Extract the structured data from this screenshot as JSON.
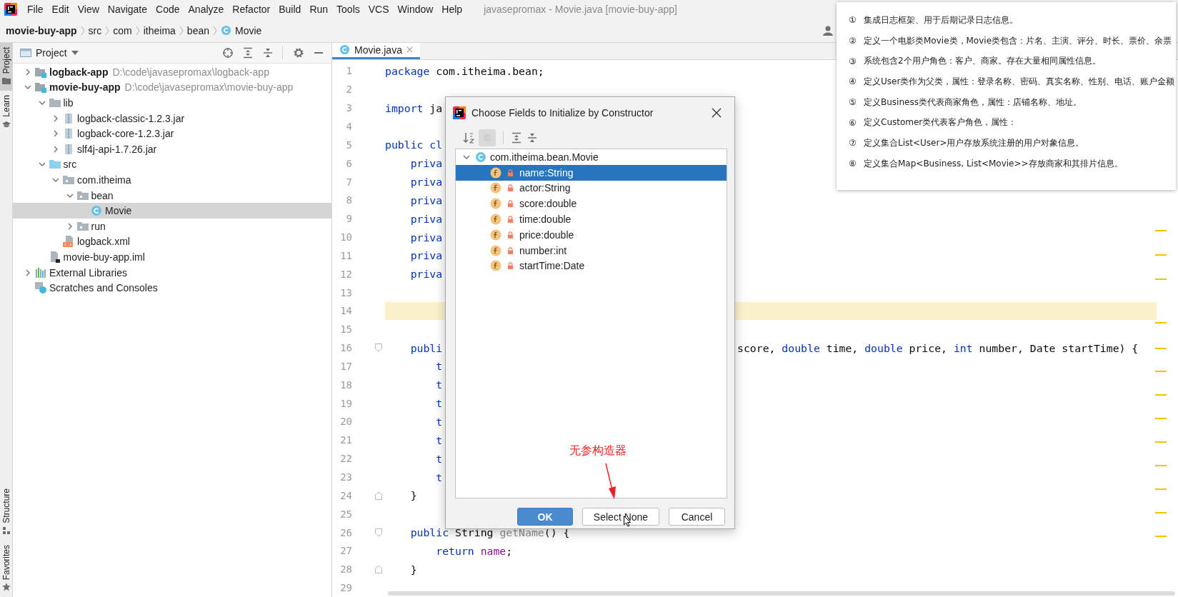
{
  "menu": {
    "items": [
      "File",
      "Edit",
      "View",
      "Navigate",
      "Code",
      "Analyze",
      "Refactor",
      "Build",
      "Run",
      "Tools",
      "VCS",
      "Window",
      "Help"
    ],
    "title": "javasepromax - Movie.java [movie-buy-app]"
  },
  "breadcrumb": [
    {
      "label": "movie-buy-app",
      "kind": "project"
    },
    {
      "label": "src",
      "kind": "folder"
    },
    {
      "label": "com",
      "kind": "folder"
    },
    {
      "label": "itheima",
      "kind": "folder"
    },
    {
      "label": "bean",
      "kind": "folder"
    },
    {
      "label": "Movie",
      "kind": "class"
    }
  ],
  "tool_strip": {
    "top": [
      {
        "label": "Project",
        "kind": "folder",
        "selected": true
      },
      {
        "label": "Learn",
        "kind": "hat",
        "selected": false
      }
    ],
    "bottom": [
      {
        "label": "Structure",
        "kind": "structure",
        "selected": false
      },
      {
        "label": "Favorites",
        "kind": "star",
        "selected": false
      }
    ]
  },
  "project": {
    "title": "Project",
    "tree": [
      {
        "label": "logback-app",
        "path": "D:\\code\\javasepromax\\logback-app",
        "kind": "module",
        "expanded": false,
        "selected": false
      },
      {
        "label": "movie-buy-app",
        "path": "D:\\code\\javasepromax\\movie-buy-app",
        "kind": "module",
        "expanded": true,
        "selected": false,
        "children": [
          {
            "label": "lib",
            "kind": "folder",
            "expanded": true,
            "selected": false,
            "children": [
              {
                "label": "logback-classic-1.2.3.jar",
                "kind": "jar",
                "expanded": false,
                "selected": false
              },
              {
                "label": "logback-core-1.2.3.jar",
                "kind": "jar",
                "expanded": false,
                "selected": false
              },
              {
                "label": "slf4j-api-1.7.26.jar",
                "kind": "jar",
                "expanded": false,
                "selected": false
              }
            ]
          },
          {
            "label": "src",
            "kind": "source",
            "expanded": true,
            "selected": false,
            "children": [
              {
                "label": "com.itheima",
                "kind": "package",
                "expanded": true,
                "selected": false,
                "children": [
                  {
                    "label": "bean",
                    "kind": "package",
                    "expanded": true,
                    "selected": false,
                    "children": [
                      {
                        "label": "Movie",
                        "kind": "class",
                        "selected": true
                      }
                    ]
                  },
                  {
                    "label": "run",
                    "kind": "package",
                    "expanded": false,
                    "selected": false
                  }
                ]
              },
              {
                "label": "logback.xml",
                "kind": "xml",
                "selected": false
              }
            ]
          },
          {
            "label": "movie-buy-app.iml",
            "kind": "iml",
            "selected": false
          }
        ]
      },
      {
        "label": "External Libraries",
        "kind": "libraries",
        "expanded": false,
        "selected": false
      },
      {
        "label": "Scratches and Consoles",
        "kind": "scratches",
        "selected": false
      }
    ]
  },
  "editor": {
    "tabs": [
      {
        "label": "Movie.java",
        "selected": true
      }
    ],
    "lines": [
      {
        "number": "1",
        "current": false,
        "left": [
          {
            "kind": "keyword",
            "text": "package"
          },
          {
            "kind": "plain",
            "text": " com.itheima.bean;"
          }
        ]
      },
      {
        "number": "2",
        "current": false
      },
      {
        "number": "3",
        "current": false,
        "left": [
          {
            "kind": "keyword",
            "text": "import"
          },
          {
            "kind": "plain",
            "text": " ja"
          }
        ]
      },
      {
        "number": "4",
        "current": false
      },
      {
        "number": "5",
        "current": false,
        "left": [
          {
            "kind": "keyword",
            "text": "public cl"
          }
        ]
      },
      {
        "number": "6",
        "current": false,
        "left": [
          {
            "kind": "keyword",
            "text": "    priva"
          }
        ]
      },
      {
        "number": "7",
        "current": false,
        "left": [
          {
            "kind": "keyword",
            "text": "    priva"
          }
        ]
      },
      {
        "number": "8",
        "current": false,
        "left": [
          {
            "kind": "keyword",
            "text": "    priva"
          }
        ]
      },
      {
        "number": "9",
        "current": false,
        "left": [
          {
            "kind": "keyword",
            "text": "    priva"
          }
        ]
      },
      {
        "number": "10",
        "current": false,
        "left": [
          {
            "kind": "keyword",
            "text": "    priva"
          }
        ]
      },
      {
        "number": "11",
        "current": false,
        "left": [
          {
            "kind": "keyword",
            "text": "    priva"
          }
        ]
      },
      {
        "number": "12",
        "current": false,
        "left": [
          {
            "kind": "keyword",
            "text": "    priva"
          }
        ]
      },
      {
        "number": "13",
        "current": false
      },
      {
        "number": "14",
        "current": true
      },
      {
        "number": "15",
        "current": false
      },
      {
        "number": "16",
        "current": false,
        "kind": "fold_start",
        "left": [
          {
            "kind": "keyword",
            "text": "    publi"
          }
        ],
        "right": [
          {
            "kind": "plain",
            "text": "score, "
          },
          {
            "kind": "keyword",
            "text": "double"
          },
          {
            "kind": "plain",
            "text": " time, "
          },
          {
            "kind": "keyword",
            "text": "double"
          },
          {
            "kind": "plain",
            "text": " price, "
          },
          {
            "kind": "keyword",
            "text": "int"
          },
          {
            "kind": "plain",
            "text": " number, Date startTime) {"
          }
        ]
      },
      {
        "number": "17",
        "current": false,
        "left": [
          {
            "kind": "keyword",
            "text": "        t"
          }
        ]
      },
      {
        "number": "18",
        "current": false,
        "left": [
          {
            "kind": "keyword",
            "text": "        t"
          }
        ]
      },
      {
        "number": "19",
        "current": false,
        "left": [
          {
            "kind": "keyword",
            "text": "        t"
          }
        ]
      },
      {
        "number": "20",
        "current": false,
        "left": [
          {
            "kind": "keyword",
            "text": "        t"
          }
        ]
      },
      {
        "number": "21",
        "current": false,
        "left": [
          {
            "kind": "keyword",
            "text": "        t"
          }
        ]
      },
      {
        "number": "22",
        "current": false,
        "left": [
          {
            "kind": "keyword",
            "text": "        t"
          }
        ]
      },
      {
        "number": "23",
        "current": false,
        "left": [
          {
            "kind": "keyword",
            "text": "        t"
          }
        ]
      },
      {
        "number": "24",
        "current": false,
        "kind": "fold_end",
        "left": [
          {
            "kind": "plain",
            "text": "    }"
          }
        ]
      },
      {
        "number": "25",
        "current": false
      },
      {
        "number": "26",
        "current": false,
        "kind": "fold_start",
        "left": [
          {
            "kind": "keyword",
            "text": "    public"
          },
          {
            "kind": "plain",
            "text": " String "
          },
          {
            "kind": "unused",
            "text": "getName"
          },
          {
            "kind": "plain",
            "text": "() {"
          }
        ]
      },
      {
        "number": "27",
        "current": false,
        "left": [
          {
            "kind": "keyword",
            "text": "        return "
          },
          {
            "kind": "field",
            "text": "name"
          },
          {
            "kind": "plain",
            "text": ";"
          }
        ]
      },
      {
        "number": "28",
        "current": false,
        "kind": "fold_end",
        "left": [
          {
            "kind": "plain",
            "text": "    }"
          }
        ]
      },
      {
        "number": "29",
        "current": false
      }
    ]
  },
  "dialog": {
    "title": "Choose Fields to Initialize by Constructor",
    "class_filter_on": true,
    "tree": [
      {
        "label": "com.itheima.bean.Movie",
        "kind": "class",
        "expanded": true,
        "selected": false,
        "children": [
          {
            "label": "name:String",
            "kind": "field",
            "selected": true
          },
          {
            "label": "actor:String",
            "kind": "field",
            "selected": false
          },
          {
            "label": "score:double",
            "kind": "field",
            "selected": false
          },
          {
            "label": "time:double",
            "kind": "field",
            "selected": false
          },
          {
            "label": "price:double",
            "kind": "field",
            "selected": false
          },
          {
            "label": "number:int",
            "kind": "field",
            "selected": false
          },
          {
            "label": "startTime:Date",
            "kind": "field",
            "selected": false
          }
        ]
      }
    ],
    "buttons": [
      {
        "label": "OK",
        "kind": "primary"
      },
      {
        "label": "Select None",
        "kind": "normal"
      },
      {
        "label": "Cancel",
        "kind": "normal"
      }
    ]
  },
  "annotation": {
    "text": "无参构造器"
  },
  "notes": [
    {
      "num": "①",
      "text": "集成日志框架、用于后期记录日志信息。"
    },
    {
      "num": "②",
      "text": "定义一个电影类Movie类，Movie类包含：片名、主演、评分、时长、票价、余票"
    },
    {
      "num": "③",
      "text": "系统包含2个用户角色：客户、商家。存在大量相同属性信息。"
    },
    {
      "num": "④",
      "text": "定义User类作为父类，属性：登录名称、密码、真实名称、性别、电话、账户金额"
    },
    {
      "num": "⑤",
      "text": "定义Business类代表商家角色，属性：店铺名称、地址。"
    },
    {
      "num": "⑥",
      "text": "定义Customer类代表客户角色，属性："
    },
    {
      "num": "⑦",
      "text": "定义集合List<User>用户存放系统注册的用户对象信息。"
    },
    {
      "num": "⑧",
      "text": "定义集合Map<Business, List<Movie>>存放商家和其排片信息。"
    }
  ]
}
